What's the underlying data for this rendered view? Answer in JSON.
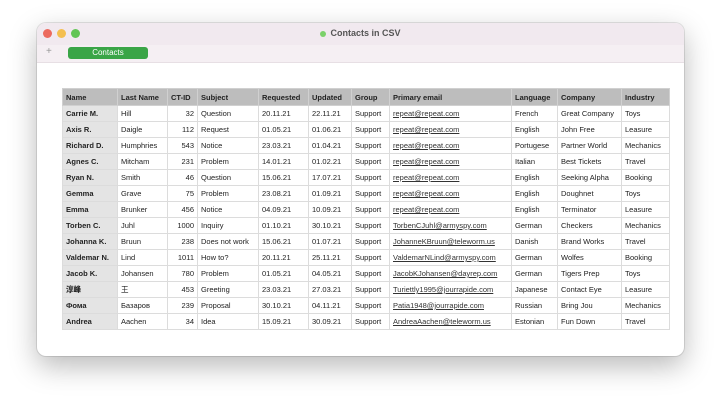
{
  "window": {
    "title": "Contacts in CSV"
  },
  "tabs": {
    "add_symbol": "+",
    "active": "Contacts"
  },
  "table": {
    "headers": [
      "Name",
      "Last Name",
      "CT-ID",
      "Subject",
      "Requested",
      "Updated",
      "Group",
      "Primary email",
      "Language",
      "Company",
      "Industry"
    ],
    "rows": [
      [
        "Carrie M.",
        "Hill",
        "32",
        "Question",
        "20.11.21",
        "22.11.21",
        "Support",
        "repeat@repeat.com",
        "French",
        "Great Company",
        "Toys"
      ],
      [
        "Axis R.",
        "Daigle",
        "112",
        "Request",
        "01.05.21",
        "01.06.21",
        "Support",
        "repeat@repeat.com",
        "English",
        "John Free",
        "Leasure"
      ],
      [
        "Richard D.",
        "Humphries",
        "543",
        "Notice",
        "23.03.21",
        "01.04.21",
        "Support",
        "repeat@repeat.com",
        "Portugese",
        "Partner World",
        "Mechanics"
      ],
      [
        "Agnes C.",
        "Mitcham",
        "231",
        "Problem",
        "14.01.21",
        "01.02.21",
        "Support",
        "repeat@repeat.com",
        "Italian",
        "Best Tickets",
        "Travel"
      ],
      [
        "Ryan N.",
        "Smith",
        "46",
        "Question",
        "15.06.21",
        "17.07.21",
        "Support",
        "repeat@repeat.com",
        "English",
        "Seeking Alpha",
        "Booking"
      ],
      [
        "Gemma",
        "Grave",
        "75",
        "Problem",
        "23.08.21",
        "01.09.21",
        "Support",
        "repeat@repeat.com",
        "English",
        "Doughnet",
        "Toys"
      ],
      [
        "Emma",
        "Brunker",
        "456",
        "Notice",
        "04.09.21",
        "10.09.21",
        "Support",
        "repeat@repeat.com",
        "English",
        "Terminator",
        "Leasure"
      ],
      [
        "Torben C.",
        "Juhl",
        "1000",
        "Inquiry",
        "01.10.21",
        "30.10.21",
        "Support",
        "TorbenCJuhl@armyspy.com",
        "German",
        "Checkers",
        "Mechanics"
      ],
      [
        "Johanna K.",
        "Bruun",
        "238",
        "Does not work",
        "15.06.21",
        "01.07.21",
        "Support",
        "JohanneKBruun@teleworm.us",
        "Danish",
        "Brand Works",
        "Travel"
      ],
      [
        "Valdemar N.",
        "Lind",
        "1011",
        "How to?",
        "20.11.21",
        "25.11.21",
        "Support",
        "ValdemarNLind@armyspy.com",
        "German",
        "Wolfes",
        "Booking"
      ],
      [
        "Jacob K.",
        "Johansen",
        "780",
        "Problem",
        "01.05.21",
        "04.05.21",
        "Support",
        "JacobKJohansen@dayrep.com",
        "German",
        "Tigers Prep",
        "Toys"
      ],
      [
        "淳峰",
        "王",
        "453",
        "Greeting",
        "23.03.21",
        "27.03.21",
        "Support",
        "Turiettly1995@jourrapide.com",
        "Japanese",
        "Contact Eye",
        "Leasure"
      ],
      [
        "Фома",
        "Базаров",
        "239",
        "Proposal",
        "30.10.21",
        "04.11.21",
        "Support",
        "Patia1948@jourrapide.com",
        "Russian",
        "Bring Jou",
        "Mechanics"
      ],
      [
        "Andrea",
        "Aachen",
        "34",
        "Idea",
        "15.09.21",
        "30.09.21",
        "Support",
        "AndreaAachen@teleworm.us",
        "Estonian",
        "Fun Down",
        "Travel"
      ]
    ]
  }
}
